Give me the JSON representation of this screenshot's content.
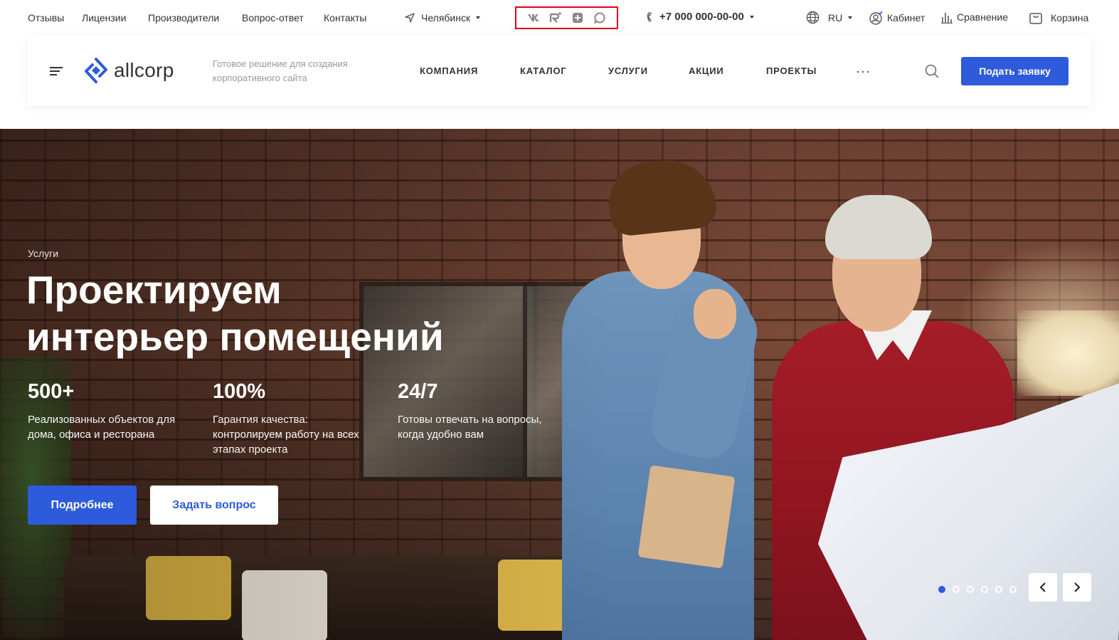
{
  "topbar": {
    "links": [
      "Отзывы",
      "Лицензии",
      "Производители",
      "Вопрос-ответ",
      "Контакты"
    ],
    "city": "Челябинск",
    "social": [
      "vk-icon",
      "rutube-icon",
      "odnoklassniki-icon",
      "chat-icon"
    ],
    "phone": "+7 000 000-00-00",
    "lang": "RU",
    "cabinet": "Кабинет",
    "compare": "Сравнение",
    "cart": "Корзина"
  },
  "header": {
    "logo": "allcorp",
    "tagline": "Готовое решение для создания корпоративного сайта",
    "nav": [
      "КОМПАНИЯ",
      "КАТАЛОГ",
      "УСЛУГИ",
      "АКЦИИ",
      "ПРОЕКТЫ"
    ],
    "more": "···",
    "cta": "Подать заявку"
  },
  "hero": {
    "eyebrow": "Услуги",
    "title_line1": "Проектируем",
    "title_line2": "интерьер помещений",
    "stats": [
      {
        "number": "500+",
        "desc": "Реализованных объектов для дома, офиса и ресторана"
      },
      {
        "number": "100%",
        "desc": "Гарантия качества: контролируем работу на всех этапах проекта"
      },
      {
        "number": "24/7",
        "desc": "Готовы отвечать на вопросы, когда удобно вам"
      }
    ],
    "btn_more": "Подробнее",
    "btn_ask": "Задать вопрос",
    "slides_total": 6,
    "slide_active": 1
  },
  "colors": {
    "accent": "#2e5bdb",
    "highlight": "#e3001b"
  }
}
